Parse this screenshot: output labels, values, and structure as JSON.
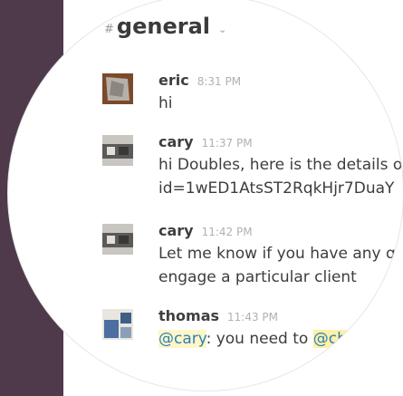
{
  "channel": {
    "name": "general"
  },
  "messages": [
    {
      "author": "eric",
      "time": "8:31 PM",
      "lines": [
        "hi"
      ]
    },
    {
      "author": "cary",
      "time": "11:37 PM",
      "lines": [
        "hi Doubles, here is the details on",
        "id=1wED1AtsST2RqkHjr7DuaY"
      ]
    },
    {
      "author": "cary",
      "time": "11:42 PM",
      "lines": [
        "Let me know if you have any que",
        "engage a particular client"
      ]
    },
    {
      "author": "thomas",
      "time": "11:43 PM",
      "mention": "@cary",
      "text": ": you need to ",
      "highlight": "@cha"
    }
  ],
  "colors": {
    "sidebar": "#4e3a4b",
    "sidebar_active": "#4c9689",
    "mention": "#2a80b9",
    "highlight": "#fff0a8"
  }
}
